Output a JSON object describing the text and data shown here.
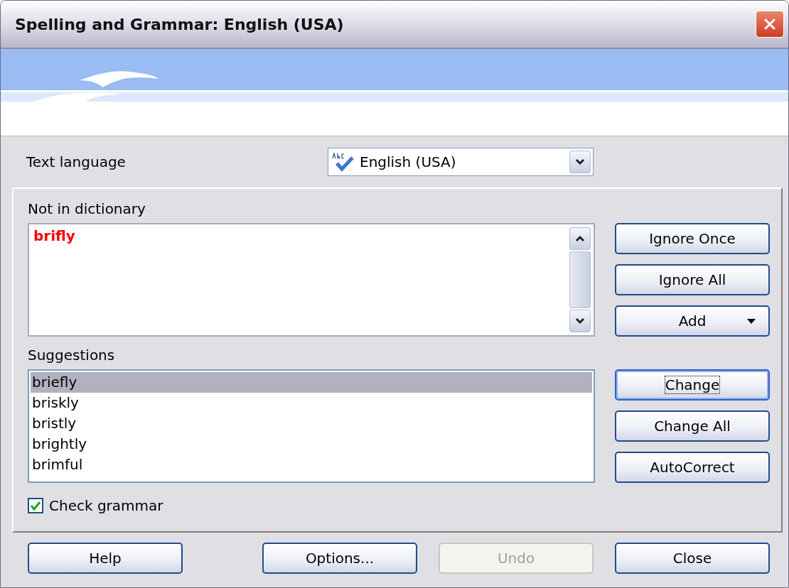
{
  "window": {
    "title": "Spelling and Grammar: English (USA)"
  },
  "text_language": {
    "label": "Text language",
    "value": "English (USA)"
  },
  "not_in_dictionary": {
    "label": "Not in dictionary",
    "word": "brifly"
  },
  "suggestions": {
    "label": "Suggestions",
    "items": [
      {
        "text": "briefly",
        "selected": true
      },
      {
        "text": "briskly",
        "selected": false
      },
      {
        "text": "bristly",
        "selected": false
      },
      {
        "text": "brightly",
        "selected": false
      },
      {
        "text": "brimful",
        "selected": false
      }
    ]
  },
  "check_grammar": {
    "label": "Check grammar",
    "checked": true
  },
  "side_buttons": [
    {
      "label": "Ignore Once",
      "kind": "plain",
      "focused": false
    },
    {
      "label": "Ignore All",
      "kind": "plain",
      "focused": false
    },
    {
      "label": "Add",
      "kind": "menu",
      "focused": false
    },
    {
      "label": "Change",
      "kind": "plain",
      "focused": true
    },
    {
      "label": "Change All",
      "kind": "plain",
      "focused": false
    },
    {
      "label": "AutoCorrect",
      "kind": "plain",
      "focused": false
    }
  ],
  "bottom_buttons": [
    {
      "label": "Help",
      "disabled": false
    },
    {
      "label": "Options...",
      "disabled": false
    },
    {
      "label": "Undo",
      "disabled": true
    },
    {
      "label": "Close",
      "disabled": false
    }
  ]
}
